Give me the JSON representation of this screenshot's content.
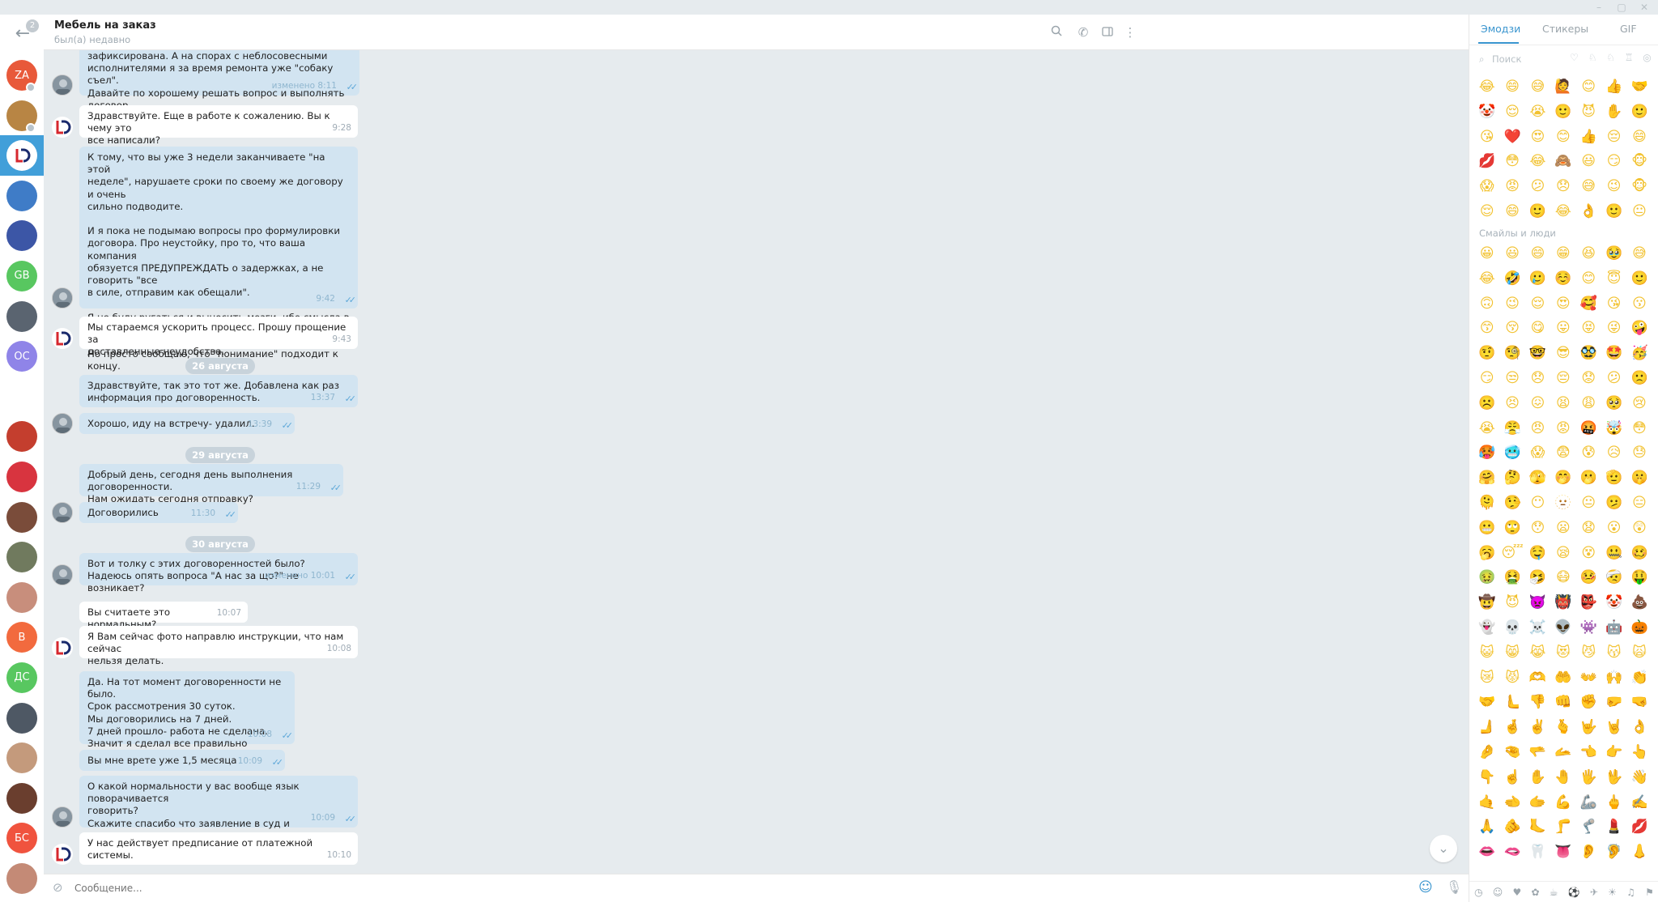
{
  "window": {
    "controls": [
      "–",
      "▢",
      "✕"
    ]
  },
  "sidebar": {
    "unread_count": "2",
    "avatars": [
      {
        "initials": "ZA",
        "color": "#e8593a"
      },
      {
        "initials": "",
        "color": "#b88544"
      },
      {
        "initials": "LD",
        "color": "#ffffff"
      },
      {
        "initials": "",
        "color": "#3f7cc7"
      },
      {
        "initials": "",
        "color": "#3c56a6"
      },
      {
        "initials": "GB",
        "color": "#58c760"
      },
      {
        "initials": "",
        "color": "#5a6470"
      },
      {
        "initials": "OC",
        "color": "#8f84e8"
      },
      {
        "initials": "",
        "color": "#ffffff"
      },
      {
        "initials": "",
        "color": "#c43e2e"
      },
      {
        "initials": "",
        "color": "#d8343f"
      },
      {
        "initials": "",
        "color": "#7a4c3a"
      },
      {
        "initials": "",
        "color": "#707a5e"
      },
      {
        "initials": "",
        "color": "#c88e7c"
      },
      {
        "initials": "B",
        "color": "#f26a3e"
      },
      {
        "initials": "ДС",
        "color": "#58c760"
      },
      {
        "initials": "",
        "color": "#4e5864"
      },
      {
        "initials": "",
        "color": "#c49a7c"
      },
      {
        "initials": "",
        "color": "#6a3e2e"
      },
      {
        "initials": "БС",
        "color": "#f0533e"
      },
      {
        "initials": "",
        "color": "#c48a76"
      }
    ]
  },
  "header": {
    "title": "Мебель на заказ",
    "status": "был(а) недавно",
    "icons": [
      "search-icon",
      "phone-icon",
      "sidebar-toggle-icon",
      "more-icon"
    ]
  },
  "messages": [
    {
      "dir": "out",
      "text": "зафиксирована. А на спорах с неблосовесными\nисполнителями я за время ремонта уже \"собаку съел\".\nДавайте по хорошему решать вопрос и выполнять договор.",
      "time": "изменено 8:11",
      "read": true
    },
    {
      "dir": "in",
      "text": "Здравствуйте. Еще в работе к сожалению. Вы к чему это\nвсе написали?",
      "time": "9:28"
    },
    {
      "dir": "out",
      "text": "К тому, что вы уже 3 недели заканчиваете \"на этой\nнеделе\", нарушаете сроки по своему же договору и очень\nсильно подводите.\n\nИ я пока не подымаю вопросы про формулировки\nдоговора. Про неустойку, про то, что ваша компания\nобязуется ПРЕДУПРЕЖДАТЬ о задержках, а не говорить \"все\nв силе, отправим как обещали\".\n\nЯ не буду ругаться и выносить мозги, ибо смысла в этом\nнет.\nНо просто сообщаю, что \"понимание\" подходит к концу.",
      "time": "9:42",
      "read": true
    },
    {
      "dir": "in",
      "text": "Мы стараемся ускорить процесс. Прошу прощение за\nдоставленные неудобства.",
      "time": "9:43"
    },
    {
      "date": "26 августа"
    },
    {
      "dir": "out",
      "text": "Здравствуйте, так это тот же. Добавлена как раз\nинформация про договоренность.",
      "time": "13:37",
      "read": true
    },
    {
      "dir": "out",
      "text": "Хорошо, иду на встречу- удалил.",
      "time": "13:39",
      "read": true
    },
    {
      "date": "29 августа"
    },
    {
      "dir": "out",
      "text": "Добрый день, сегодня день выполнения договоренности.\nНам ожидать сегодня отправку?",
      "time": "11:29",
      "read": true
    },
    {
      "dir": "out",
      "text": "Договорились",
      "time": "11:30",
      "read": true
    },
    {
      "date": "30 августа"
    },
    {
      "dir": "out",
      "text": "Вот и толку с этих договоренностей было?\nНадеюсь опять вопроса \"А нас за що?\" не возникает?",
      "time": "изменено 10:01",
      "read": true
    },
    {
      "dir": "in",
      "text": "Вы считаете это нормальным?",
      "time": "10:07"
    },
    {
      "dir": "in",
      "text": "Я Вам сейчас фото направлю инструкции, что нам сейчас\nнельзя делать.",
      "time": "10:08"
    },
    {
      "dir": "out",
      "text": "Да. На тот момент договоренности не было.\nСрок рассмотрения 30 суток.\nМы договорились на 7 дней.\n7 дней прошло- работа не сделана.\nЗначит я сделал все правильно",
      "time": "10:08",
      "read": true
    },
    {
      "dir": "out",
      "text": "Вы мне врете уже 1,5 месяца",
      "time": "10:09",
      "read": true
    },
    {
      "dir": "out",
      "text": "О какой нормальности у вас вообще язык поворачивается\nговорить?\nСкажите спасибо что заявление в суд и прокуратуру еще на\nруках, а не передано",
      "time": "10:09",
      "read": true
    },
    {
      "dir": "in",
      "text": "У нас действует предписание от платежной системы.",
      "time": "10:10"
    }
  ],
  "input": {
    "placeholder": "Сообщение..."
  },
  "emoji_panel": {
    "tabs": [
      "Эмодзи",
      "Стикеры",
      "GIF"
    ],
    "search_placeholder": "Поиск",
    "section_title": "Смайлы и люди",
    "recent": [
      "😂",
      "😄",
      "😅",
      "🙋",
      "😊",
      "👍",
      "🤝",
      "🤡",
      "😌",
      "😭",
      "🙂",
      "😈",
      "✋",
      "🙂",
      "😘",
      "❤️",
      "😍",
      "😊",
      "👍",
      "😔",
      "😄",
      "💋",
      "😳",
      "😂",
      "🙈",
      "😃",
      "😏",
      "🐵",
      "😱",
      "😡",
      "😕",
      "😞",
      "😅",
      "😉",
      "🐵",
      "😌",
      "😄",
      "🙂",
      "😂",
      "👌",
      "🙂",
      "😐"
    ],
    "grid": [
      "😀",
      "😃",
      "😄",
      "😁",
      "😆",
      "🥹",
      "😅",
      "😂",
      "🤣",
      "🥲",
      "☺️",
      "😊",
      "😇",
      "🙂",
      "🙃",
      "😉",
      "😌",
      "😍",
      "🥰",
      "😘",
      "😗",
      "😙",
      "😚",
      "😋",
      "😛",
      "😝",
      "😜",
      "🤪",
      "🤨",
      "🧐",
      "🤓",
      "😎",
      "🥸",
      "🤩",
      "🥳",
      "😏",
      "😒",
      "😞",
      "😔",
      "😟",
      "😕",
      "🙁",
      "☹️",
      "😣",
      "😖",
      "😫",
      "😩",
      "🥺",
      "😢",
      "😭",
      "😤",
      "😠",
      "😡",
      "🤬",
      "🤯",
      "😳",
      "🥵",
      "🥶",
      "😱",
      "😨",
      "😰",
      "😥",
      "😓",
      "🤗",
      "🤔",
      "🫣",
      "🤭",
      "🫢",
      "🫡",
      "🤫",
      "🫠",
      "🤥",
      "😶",
      "🫥",
      "😐",
      "🫤",
      "😑",
      "😬",
      "🙄",
      "😯",
      "😦",
      "😧",
      "😮",
      "😲",
      "🥱",
      "😴",
      "🤤",
      "😪",
      "😵",
      "🤐",
      "🥴",
      "🤢",
      "🤮",
      "🤧",
      "😷",
      "🤒",
      "🤕",
      "🤑",
      "🤠",
      "😈",
      "👿",
      "👹",
      "👺",
      "🤡",
      "💩",
      "👻",
      "💀",
      "☠️",
      "👽",
      "👾",
      "🤖",
      "🎃",
      "😺",
      "😸",
      "😹",
      "😻",
      "😼",
      "😽",
      "🙀",
      "😿",
      "😾",
      "🫶",
      "🤲",
      "👐",
      "🙌",
      "👏",
      "🤝",
      "🫷",
      "👎",
      "👊",
      "✊",
      "🤛",
      "🤜",
      "🫸",
      "🤞",
      "✌️",
      "🫰",
      "🤟",
      "🤘",
      "👌",
      "🤌",
      "🤏",
      "🫳",
      "🫴",
      "👈",
      "👉",
      "👆",
      "👇",
      "☝️",
      "✋",
      "🤚",
      "🖐️",
      "🖖",
      "👋",
      "🤙",
      "🫲",
      "🫱",
      "💪",
      "🦾",
      "🖕",
      "✍️",
      "🙏",
      "🫵",
      "🦶",
      "🦵",
      "🦿",
      "💄",
      "💋",
      "👄",
      "🫦",
      "🦷",
      "👅",
      "👂",
      "🦻",
      "👃"
    ],
    "categories": [
      "clock-icon",
      "smile-icon",
      "heart-icon",
      "paw-icon",
      "food-icon",
      "ball-icon",
      "car-icon",
      "bulb-icon",
      "symbol-icon",
      "flag-icon"
    ]
  }
}
